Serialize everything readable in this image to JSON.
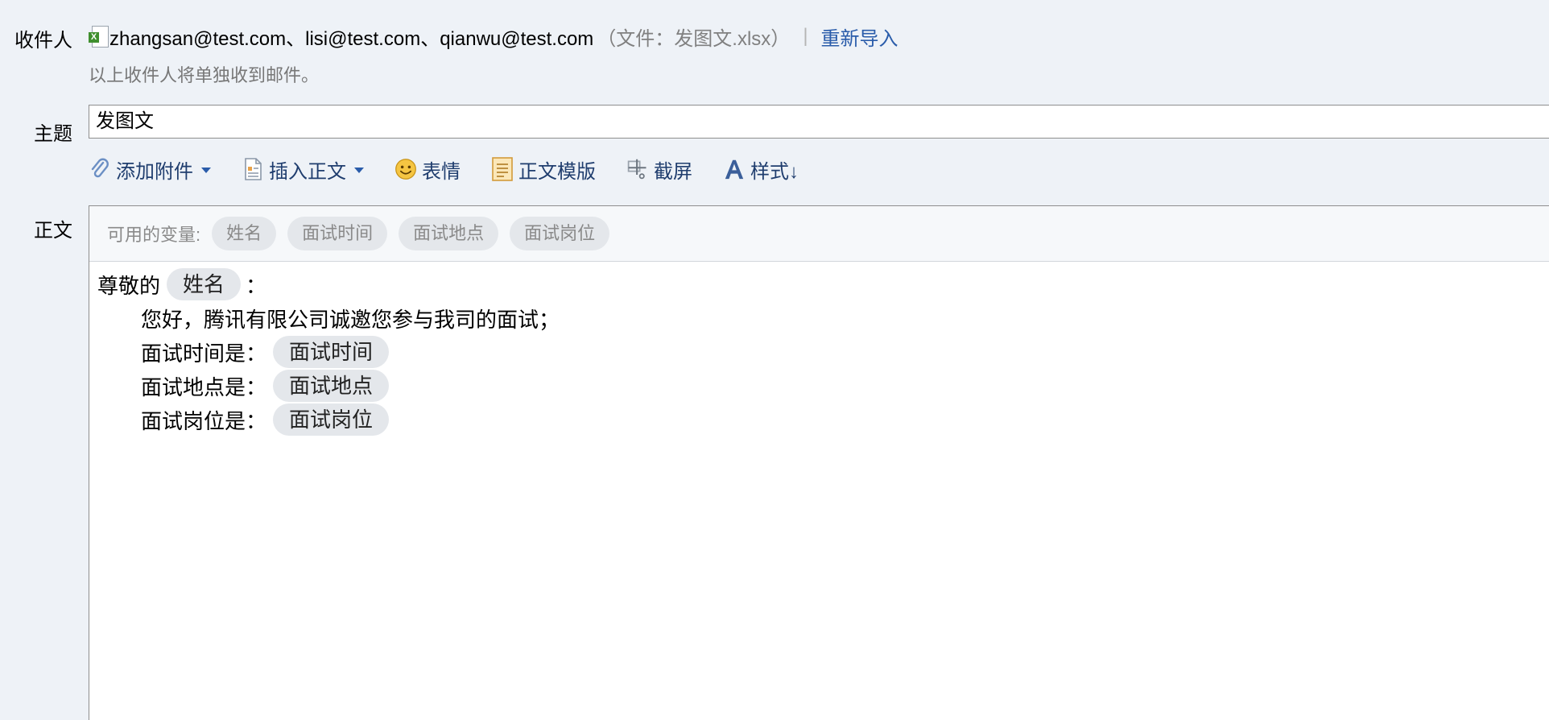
{
  "labels": {
    "recipients": "收件人",
    "subject": "主题",
    "body": "正文"
  },
  "recipients": {
    "list": "zhangsan@test.com、lisi@test.com、qianwu@test.com",
    "file_note": "（文件：发图文.xlsx）",
    "separator": "|",
    "reimport": "重新导入",
    "hint": "以上收件人将单独收到邮件。",
    "file_icon": "excel-file-icon"
  },
  "subject": {
    "value": "发图文"
  },
  "toolbar": {
    "attach": "添加附件",
    "insert_body": "插入正文",
    "emoji": "表情",
    "template": "正文模版",
    "screenshot": "截屏",
    "style": "样式↓"
  },
  "variables": {
    "label": "可用的变量:",
    "items": [
      "姓名",
      "面试时间",
      "面试地点",
      "面试岗位"
    ]
  },
  "content": {
    "greeting_prefix": "尊敬的",
    "greeting_var": "姓名",
    "greeting_suffix": "：",
    "intro": "您好，腾讯有限公司诚邀您参与我司的面试；",
    "lines": [
      {
        "label": "面试时间是：",
        "var": "面试时间"
      },
      {
        "label": "面试地点是：",
        "var": "面试地点"
      },
      {
        "label": "面试岗位是：",
        "var": "面试岗位"
      }
    ]
  },
  "colors": {
    "link": "#2a5caa",
    "toolbar_text": "#1f3d6e",
    "background": "#eef2f7",
    "chip": "#e4e7eb"
  }
}
